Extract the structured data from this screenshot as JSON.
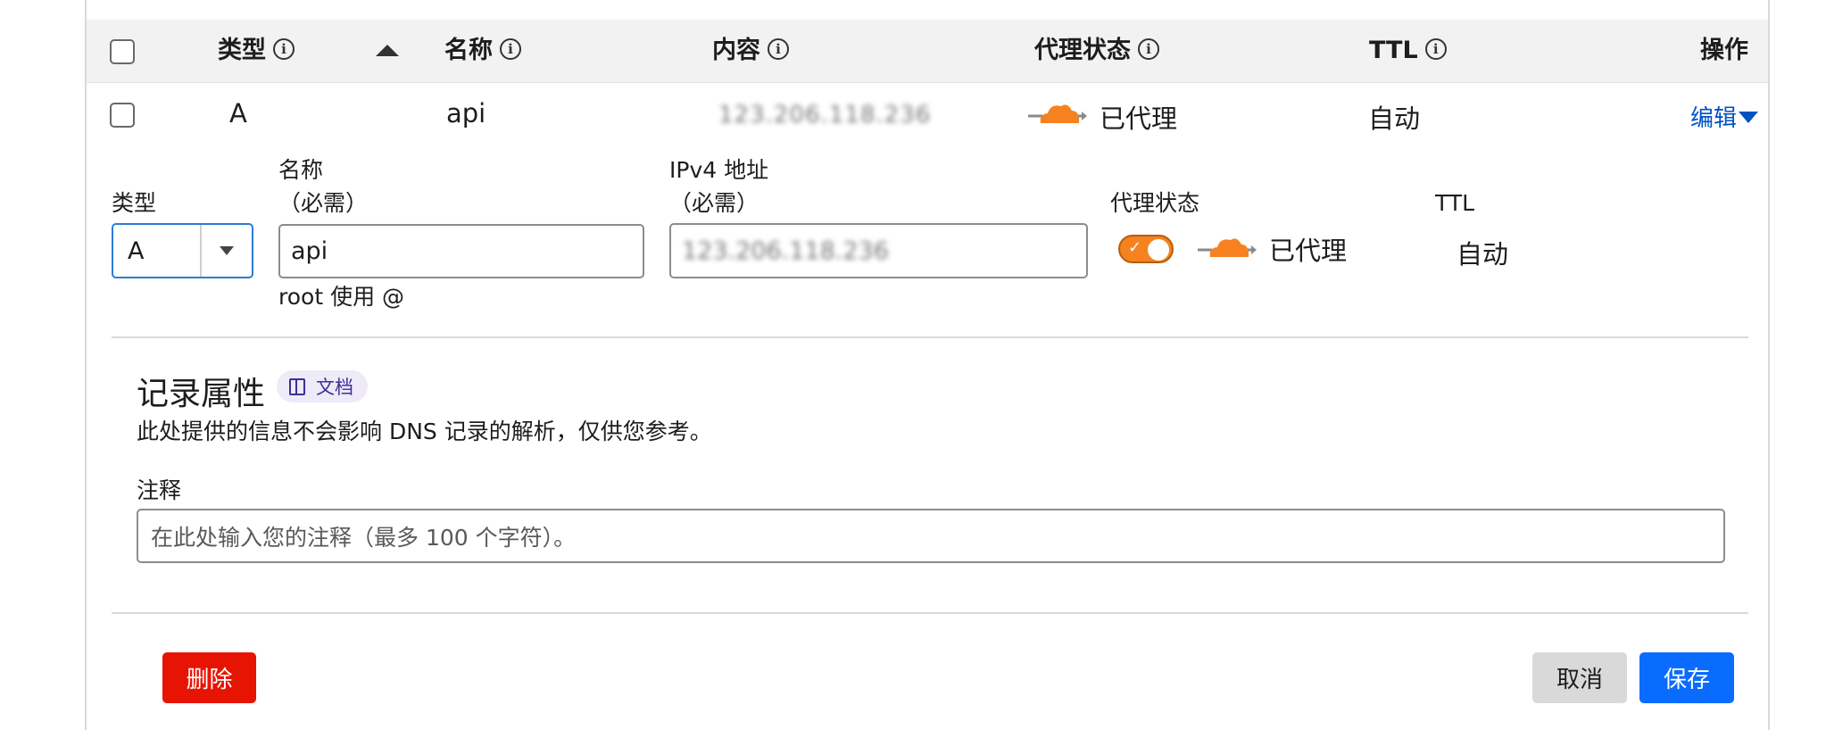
{
  "table": {
    "headers": {
      "type": "类型",
      "name": "名称",
      "content": "内容",
      "proxy_status": "代理状态",
      "ttl": "TTL",
      "actions": "操作"
    },
    "row": {
      "type": "A",
      "name": "api",
      "content": "123.206.118.236",
      "proxy_status": "已代理",
      "ttl": "自动",
      "edit_label": "编辑"
    }
  },
  "form": {
    "type_label": "类型",
    "type_value": "A",
    "name_label": "名称",
    "name_required": "（必需）",
    "name_value": "api",
    "name_hint": "root 使用 @",
    "ipv4_label": "IPv4 地址",
    "ipv4_required": "（必需）",
    "ipv4_value": "123.206.118.236",
    "proxy_label": "代理状态",
    "proxy_value": "已代理",
    "ttl_label": "TTL",
    "ttl_value": "自动"
  },
  "record_attributes": {
    "title": "记录属性",
    "docs_label": "文档",
    "description": "此处提供的信息不会影响 DNS 记录的解析，仅供您参考。",
    "comment_label": "注释",
    "comment_placeholder": "在此处输入您的注释（最多 100 个字符）。"
  },
  "actions": {
    "delete_label": "删除",
    "cancel_label": "取消",
    "save_label": "保存"
  },
  "colors": {
    "accent_blue": "#0051c3",
    "proxy_orange": "#f6821f",
    "delete_red": "#e81403",
    "save_blue": "#0a6cff"
  }
}
